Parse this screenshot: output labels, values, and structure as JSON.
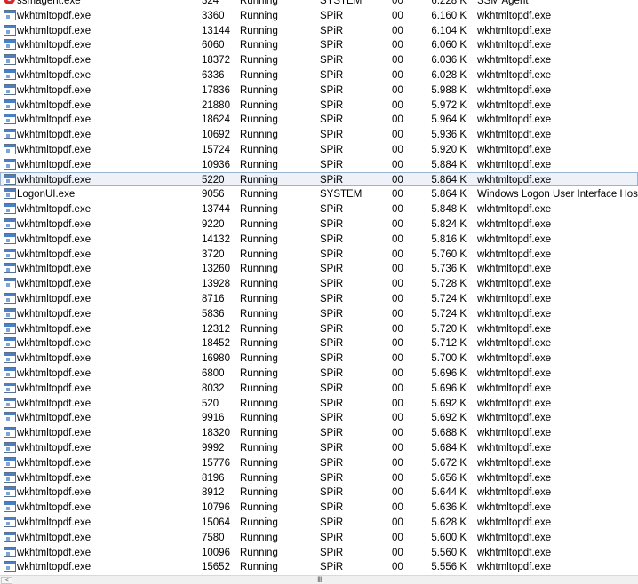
{
  "process_rows": [
    {
      "name": "ssmagent.exe",
      "pid": "324",
      "status": "Running",
      "user": "SYSTEM",
      "cpu": "00",
      "memory": "6.228 K",
      "description": "SSM Agent",
      "icon": "red-gear-icon"
    },
    {
      "name": "wkhtmltopdf.exe",
      "pid": "3360",
      "status": "Running",
      "user": "SPiR",
      "cpu": "00",
      "memory": "6.160 K",
      "description": "wkhtmltopdf.exe",
      "icon": "app-window-icon"
    },
    {
      "name": "wkhtmltopdf.exe",
      "pid": "13144",
      "status": "Running",
      "user": "SPiR",
      "cpu": "00",
      "memory": "6.104 K",
      "description": "wkhtmltopdf.exe",
      "icon": "app-window-icon"
    },
    {
      "name": "wkhtmltopdf.exe",
      "pid": "6060",
      "status": "Running",
      "user": "SPiR",
      "cpu": "00",
      "memory": "6.060 K",
      "description": "wkhtmltopdf.exe",
      "icon": "app-window-icon"
    },
    {
      "name": "wkhtmltopdf.exe",
      "pid": "18372",
      "status": "Running",
      "user": "SPiR",
      "cpu": "00",
      "memory": "6.036 K",
      "description": "wkhtmltopdf.exe",
      "icon": "app-window-icon"
    },
    {
      "name": "wkhtmltopdf.exe",
      "pid": "6336",
      "status": "Running",
      "user": "SPiR",
      "cpu": "00",
      "memory": "6.028 K",
      "description": "wkhtmltopdf.exe",
      "icon": "app-window-icon"
    },
    {
      "name": "wkhtmltopdf.exe",
      "pid": "17836",
      "status": "Running",
      "user": "SPiR",
      "cpu": "00",
      "memory": "5.988 K",
      "description": "wkhtmltopdf.exe",
      "icon": "app-window-icon"
    },
    {
      "name": "wkhtmltopdf.exe",
      "pid": "21880",
      "status": "Running",
      "user": "SPiR",
      "cpu": "00",
      "memory": "5.972 K",
      "description": "wkhtmltopdf.exe",
      "icon": "app-window-icon"
    },
    {
      "name": "wkhtmltopdf.exe",
      "pid": "18624",
      "status": "Running",
      "user": "SPiR",
      "cpu": "00",
      "memory": "5.964 K",
      "description": "wkhtmltopdf.exe",
      "icon": "app-window-icon"
    },
    {
      "name": "wkhtmltopdf.exe",
      "pid": "10692",
      "status": "Running",
      "user": "SPiR",
      "cpu": "00",
      "memory": "5.936 K",
      "description": "wkhtmltopdf.exe",
      "icon": "app-window-icon"
    },
    {
      "name": "wkhtmltopdf.exe",
      "pid": "15724",
      "status": "Running",
      "user": "SPiR",
      "cpu": "00",
      "memory": "5.920 K",
      "description": "wkhtmltopdf.exe",
      "icon": "app-window-icon"
    },
    {
      "name": "wkhtmltopdf.exe",
      "pid": "10936",
      "status": "Running",
      "user": "SPiR",
      "cpu": "00",
      "memory": "5.884 K",
      "description": "wkhtmltopdf.exe",
      "icon": "app-window-icon"
    },
    {
      "name": "wkhtmltopdf.exe",
      "pid": "5220",
      "status": "Running",
      "user": "SPiR",
      "cpu": "00",
      "memory": "5.864 K",
      "description": "wkhtmltopdf.exe",
      "icon": "app-window-icon",
      "selected": true
    },
    {
      "name": "LogonUI.exe",
      "pid": "9056",
      "status": "Running",
      "user": "SYSTEM",
      "cpu": "00",
      "memory": "5.864 K",
      "description": "Windows Logon User Interface Host",
      "icon": "app-window-icon"
    },
    {
      "name": "wkhtmltopdf.exe",
      "pid": "13744",
      "status": "Running",
      "user": "SPiR",
      "cpu": "00",
      "memory": "5.848 K",
      "description": "wkhtmltopdf.exe",
      "icon": "app-window-icon"
    },
    {
      "name": "wkhtmltopdf.exe",
      "pid": "9220",
      "status": "Running",
      "user": "SPiR",
      "cpu": "00",
      "memory": "5.824 K",
      "description": "wkhtmltopdf.exe",
      "icon": "app-window-icon"
    },
    {
      "name": "wkhtmltopdf.exe",
      "pid": "14132",
      "status": "Running",
      "user": "SPiR",
      "cpu": "00",
      "memory": "5.816 K",
      "description": "wkhtmltopdf.exe",
      "icon": "app-window-icon"
    },
    {
      "name": "wkhtmltopdf.exe",
      "pid": "3720",
      "status": "Running",
      "user": "SPiR",
      "cpu": "00",
      "memory": "5.760 K",
      "description": "wkhtmltopdf.exe",
      "icon": "app-window-icon"
    },
    {
      "name": "wkhtmltopdf.exe",
      "pid": "13260",
      "status": "Running",
      "user": "SPiR",
      "cpu": "00",
      "memory": "5.736 K",
      "description": "wkhtmltopdf.exe",
      "icon": "app-window-icon"
    },
    {
      "name": "wkhtmltopdf.exe",
      "pid": "13928",
      "status": "Running",
      "user": "SPiR",
      "cpu": "00",
      "memory": "5.728 K",
      "description": "wkhtmltopdf.exe",
      "icon": "app-window-icon"
    },
    {
      "name": "wkhtmltopdf.exe",
      "pid": "8716",
      "status": "Running",
      "user": "SPiR",
      "cpu": "00",
      "memory": "5.724 K",
      "description": "wkhtmltopdf.exe",
      "icon": "app-window-icon"
    },
    {
      "name": "wkhtmltopdf.exe",
      "pid": "5836",
      "status": "Running",
      "user": "SPiR",
      "cpu": "00",
      "memory": "5.724 K",
      "description": "wkhtmltopdf.exe",
      "icon": "app-window-icon"
    },
    {
      "name": "wkhtmltopdf.exe",
      "pid": "12312",
      "status": "Running",
      "user": "SPiR",
      "cpu": "00",
      "memory": "5.720 K",
      "description": "wkhtmltopdf.exe",
      "icon": "app-window-icon"
    },
    {
      "name": "wkhtmltopdf.exe",
      "pid": "18452",
      "status": "Running",
      "user": "SPiR",
      "cpu": "00",
      "memory": "5.712 K",
      "description": "wkhtmltopdf.exe",
      "icon": "app-window-icon"
    },
    {
      "name": "wkhtmltopdf.exe",
      "pid": "16980",
      "status": "Running",
      "user": "SPiR",
      "cpu": "00",
      "memory": "5.700 K",
      "description": "wkhtmltopdf.exe",
      "icon": "app-window-icon"
    },
    {
      "name": "wkhtmltopdf.exe",
      "pid": "6800",
      "status": "Running",
      "user": "SPiR",
      "cpu": "00",
      "memory": "5.696 K",
      "description": "wkhtmltopdf.exe",
      "icon": "app-window-icon"
    },
    {
      "name": "wkhtmltopdf.exe",
      "pid": "8032",
      "status": "Running",
      "user": "SPiR",
      "cpu": "00",
      "memory": "5.696 K",
      "description": "wkhtmltopdf.exe",
      "icon": "app-window-icon"
    },
    {
      "name": "wkhtmltopdf.exe",
      "pid": "520",
      "status": "Running",
      "user": "SPiR",
      "cpu": "00",
      "memory": "5.692 K",
      "description": "wkhtmltopdf.exe",
      "icon": "app-window-icon"
    },
    {
      "name": "wkhtmltopdf.exe",
      "pid": "9916",
      "status": "Running",
      "user": "SPiR",
      "cpu": "00",
      "memory": "5.692 K",
      "description": "wkhtmltopdf.exe",
      "icon": "app-window-icon"
    },
    {
      "name": "wkhtmltopdf.exe",
      "pid": "18320",
      "status": "Running",
      "user": "SPiR",
      "cpu": "00",
      "memory": "5.688 K",
      "description": "wkhtmltopdf.exe",
      "icon": "app-window-icon"
    },
    {
      "name": "wkhtmltopdf.exe",
      "pid": "9992",
      "status": "Running",
      "user": "SPiR",
      "cpu": "00",
      "memory": "5.684 K",
      "description": "wkhtmltopdf.exe",
      "icon": "app-window-icon"
    },
    {
      "name": "wkhtmltopdf.exe",
      "pid": "15776",
      "status": "Running",
      "user": "SPiR",
      "cpu": "00",
      "memory": "5.672 K",
      "description": "wkhtmltopdf.exe",
      "icon": "app-window-icon"
    },
    {
      "name": "wkhtmltopdf.exe",
      "pid": "8196",
      "status": "Running",
      "user": "SPiR",
      "cpu": "00",
      "memory": "5.656 K",
      "description": "wkhtmltopdf.exe",
      "icon": "app-window-icon"
    },
    {
      "name": "wkhtmltopdf.exe",
      "pid": "8912",
      "status": "Running",
      "user": "SPiR",
      "cpu": "00",
      "memory": "5.644 K",
      "description": "wkhtmltopdf.exe",
      "icon": "app-window-icon"
    },
    {
      "name": "wkhtmltopdf.exe",
      "pid": "10796",
      "status": "Running",
      "user": "SPiR",
      "cpu": "00",
      "memory": "5.636 K",
      "description": "wkhtmltopdf.exe",
      "icon": "app-window-icon"
    },
    {
      "name": "wkhtmltopdf.exe",
      "pid": "15064",
      "status": "Running",
      "user": "SPiR",
      "cpu": "00",
      "memory": "5.628 K",
      "description": "wkhtmltopdf.exe",
      "icon": "app-window-icon"
    },
    {
      "name": "wkhtmltopdf.exe",
      "pid": "7580",
      "status": "Running",
      "user": "SPiR",
      "cpu": "00",
      "memory": "5.600 K",
      "description": "wkhtmltopdf.exe",
      "icon": "app-window-icon"
    },
    {
      "name": "wkhtmltopdf.exe",
      "pid": "10096",
      "status": "Running",
      "user": "SPiR",
      "cpu": "00",
      "memory": "5.560 K",
      "description": "wkhtmltopdf.exe",
      "icon": "app-window-icon"
    },
    {
      "name": "wkhtmltopdf.exe",
      "pid": "15652",
      "status": "Running",
      "user": "SPiR",
      "cpu": "00",
      "memory": "5.556 K",
      "description": "wkhtmltopdf.exe",
      "icon": "app-window-icon"
    }
  ],
  "scrollbar": {
    "left_arrow": "<",
    "grip": "III"
  },
  "colors": {
    "selected_row_bg": "#eef2f8",
    "selected_row_border": "#99b4d1",
    "ssmagent_icon": "#d8262e"
  }
}
